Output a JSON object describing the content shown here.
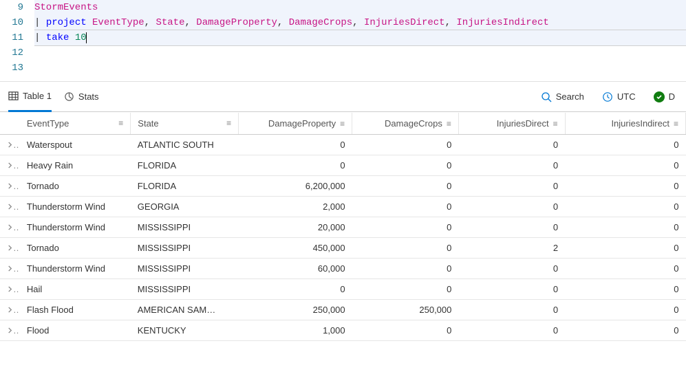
{
  "editor": {
    "lines": [
      {
        "n": 9,
        "tokens": [
          {
            "t": "StormEvents",
            "c": "tbl"
          }
        ],
        "sel": true
      },
      {
        "n": 10,
        "tokens": [
          {
            "t": "| ",
            "c": "pipe"
          },
          {
            "t": "project",
            "c": "kw"
          },
          {
            "t": " "
          },
          {
            "t": "EventType",
            "c": "col"
          },
          {
            "t": ", ",
            "c": "punct"
          },
          {
            "t": "State",
            "c": "col"
          },
          {
            "t": ", ",
            "c": "punct"
          },
          {
            "t": "DamageProperty",
            "c": "col"
          },
          {
            "t": ", ",
            "c": "punct"
          },
          {
            "t": "DamageCrops",
            "c": "col"
          },
          {
            "t": ", ",
            "c": "punct"
          },
          {
            "t": "InjuriesDirect",
            "c": "col"
          },
          {
            "t": ", ",
            "c": "punct"
          },
          {
            "t": "InjuriesIndirect",
            "c": "col"
          }
        ],
        "sel": true
      },
      {
        "n": 11,
        "tokens": [
          {
            "t": "| ",
            "c": "pipe"
          },
          {
            "t": "take",
            "c": "kw"
          },
          {
            "t": " "
          },
          {
            "t": "10",
            "c": "num"
          }
        ],
        "sel": true,
        "active": true,
        "cursor": true
      },
      {
        "n": 12,
        "tokens": []
      },
      {
        "n": 13,
        "tokens": []
      }
    ]
  },
  "header": {
    "tab1": "Table 1",
    "stats": "Stats",
    "search": "Search",
    "tz": "UTC",
    "status_suffix": "D"
  },
  "columns": [
    {
      "key": "EventType",
      "label": "EventType",
      "num": false
    },
    {
      "key": "State",
      "label": "State",
      "num": false
    },
    {
      "key": "DamageProperty",
      "label": "DamageProperty",
      "num": true
    },
    {
      "key": "DamageCrops",
      "label": "DamageCrops",
      "num": true
    },
    {
      "key": "InjuriesDirect",
      "label": "InjuriesDirect",
      "num": true
    },
    {
      "key": "InjuriesIndirect",
      "label": "InjuriesIndirect",
      "num": true
    }
  ],
  "rows": [
    {
      "EventType": "Waterspout",
      "State": "ATLANTIC SOUTH",
      "DamageProperty": "0",
      "DamageCrops": "0",
      "InjuriesDirect": "0",
      "InjuriesIndirect": "0"
    },
    {
      "EventType": "Heavy Rain",
      "State": "FLORIDA",
      "DamageProperty": "0",
      "DamageCrops": "0",
      "InjuriesDirect": "0",
      "InjuriesIndirect": "0"
    },
    {
      "EventType": "Tornado",
      "State": "FLORIDA",
      "DamageProperty": "6,200,000",
      "DamageCrops": "0",
      "InjuriesDirect": "0",
      "InjuriesIndirect": "0"
    },
    {
      "EventType": "Thunderstorm Wind",
      "State": "GEORGIA",
      "DamageProperty": "2,000",
      "DamageCrops": "0",
      "InjuriesDirect": "0",
      "InjuriesIndirect": "0"
    },
    {
      "EventType": "Thunderstorm Wind",
      "State": "MISSISSIPPI",
      "DamageProperty": "20,000",
      "DamageCrops": "0",
      "InjuriesDirect": "0",
      "InjuriesIndirect": "0"
    },
    {
      "EventType": "Tornado",
      "State": "MISSISSIPPI",
      "DamageProperty": "450,000",
      "DamageCrops": "0",
      "InjuriesDirect": "2",
      "InjuriesIndirect": "0"
    },
    {
      "EventType": "Thunderstorm Wind",
      "State": "MISSISSIPPI",
      "DamageProperty": "60,000",
      "DamageCrops": "0",
      "InjuriesDirect": "0",
      "InjuriesIndirect": "0"
    },
    {
      "EventType": "Hail",
      "State": "MISSISSIPPI",
      "DamageProperty": "0",
      "DamageCrops": "0",
      "InjuriesDirect": "0",
      "InjuriesIndirect": "0"
    },
    {
      "EventType": "Flash Flood",
      "State": "AMERICAN SAM…",
      "DamageProperty": "250,000",
      "DamageCrops": "250,000",
      "InjuriesDirect": "0",
      "InjuriesIndirect": "0"
    },
    {
      "EventType": "Flood",
      "State": "KENTUCKY",
      "DamageProperty": "1,000",
      "DamageCrops": "0",
      "InjuriesDirect": "0",
      "InjuriesIndirect": "0"
    }
  ],
  "chart_data": {
    "type": "table",
    "columns": [
      "EventType",
      "State",
      "DamageProperty",
      "DamageCrops",
      "InjuriesDirect",
      "InjuriesIndirect"
    ],
    "rows": [
      [
        "Waterspout",
        "ATLANTIC SOUTH",
        0,
        0,
        0,
        0
      ],
      [
        "Heavy Rain",
        "FLORIDA",
        0,
        0,
        0,
        0
      ],
      [
        "Tornado",
        "FLORIDA",
        6200000,
        0,
        0,
        0
      ],
      [
        "Thunderstorm Wind",
        "GEORGIA",
        2000,
        0,
        0,
        0
      ],
      [
        "Thunderstorm Wind",
        "MISSISSIPPI",
        20000,
        0,
        0,
        0
      ],
      [
        "Tornado",
        "MISSISSIPPI",
        450000,
        0,
        2,
        0
      ],
      [
        "Thunderstorm Wind",
        "MISSISSIPPI",
        60000,
        0,
        0,
        0
      ],
      [
        "Hail",
        "MISSISSIPPI",
        0,
        0,
        0,
        0
      ],
      [
        "Flash Flood",
        "AMERICAN SAM…",
        250000,
        250000,
        0,
        0
      ],
      [
        "Flood",
        "KENTUCKY",
        1000,
        0,
        0,
        0
      ]
    ]
  }
}
